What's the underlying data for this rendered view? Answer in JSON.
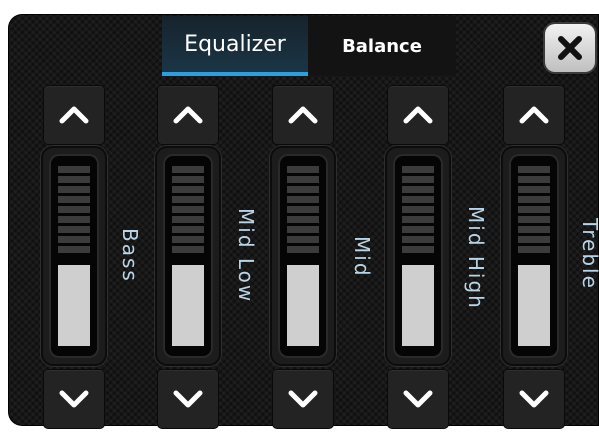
{
  "tabs": [
    {
      "label": "Equalizer",
      "active": true
    },
    {
      "label": "Balance",
      "active": false
    }
  ],
  "close_button": {
    "icon": "close-icon"
  },
  "bands": [
    {
      "label": "Bass",
      "level": 0.45
    },
    {
      "label": "Mid Low",
      "level": 0.45
    },
    {
      "label": "Mid",
      "level": 0.45
    },
    {
      "label": "Mid High",
      "level": 0.45
    },
    {
      "label": "Treble",
      "level": 0.45
    }
  ],
  "colors": {
    "accent": "#2d9fe0",
    "label_text": "#b9d4e6",
    "slider_fill": "#cfcfcf",
    "background": "#171717"
  }
}
